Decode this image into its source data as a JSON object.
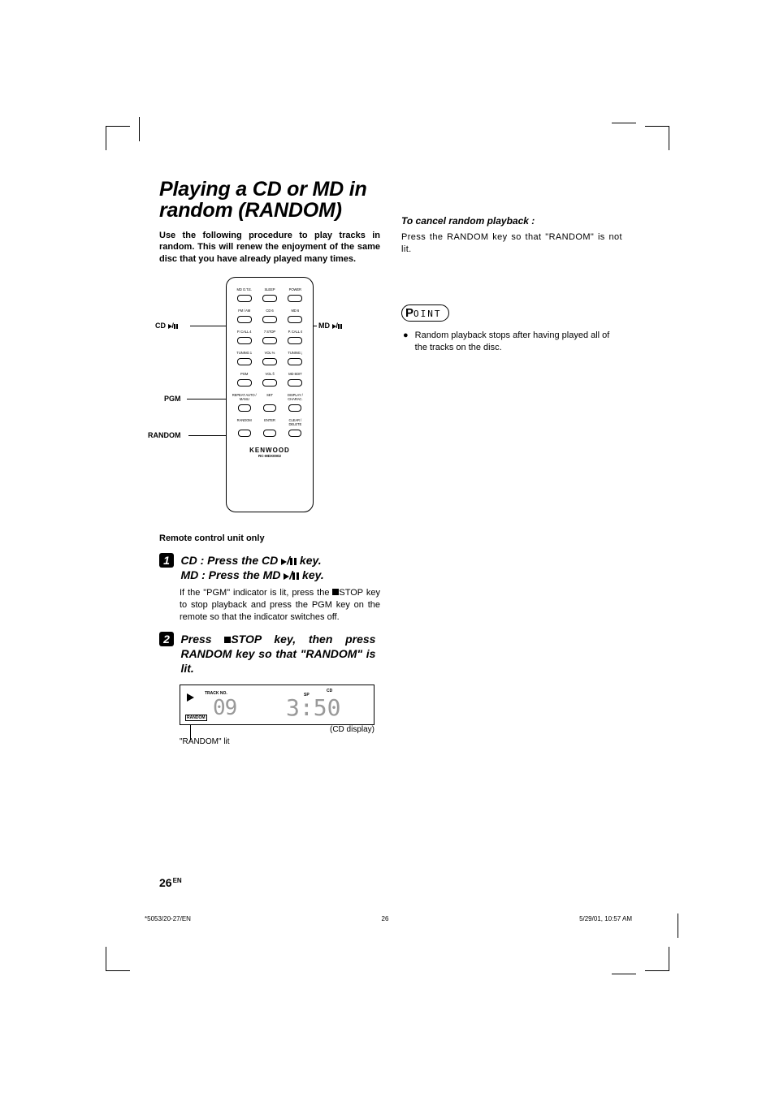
{
  "title": "Playing a CD or MD in  random (RANDOM)",
  "intro": "Use the following procedure to play tracks in random. This will renew the enjoyment of the same disc that you have already played many times.",
  "remote": {
    "row1": [
      "MD O.T.E.",
      "SLEEP",
      "POWER"
    ],
    "row2": [
      "FM / AM",
      "CD 6",
      "MD 6"
    ],
    "row3": [
      "P. CALL 4",
      "7 STOP",
      "P. CALL ¢"
    ],
    "row4": [
      "TUNING 1",
      "VOL %",
      "TUNING ¡"
    ],
    "row5": [
      "PGM",
      "VOL fi",
      "MD EDIT"
    ],
    "row6": [
      "REPEAT AUTO / MANU",
      "SET",
      "DISPLAY / CHARAC."
    ],
    "row7": [
      "RANDOM",
      "ENTER",
      "CLEAR / DELETE"
    ],
    "brand": "KENWOOD",
    "model": "RC-MDX0002"
  },
  "callouts": {
    "cd": "CD 6",
    "md": "MD 6",
    "pgm": "PGM",
    "random": "RANDOM"
  },
  "note_only": "Remote control unit only",
  "step1": {
    "num": "1",
    "line_a_prefix": "CD  :  Press the CD",
    "line_a_suffix": " key.",
    "line_b_prefix": "MD :  Press the MD",
    "line_b_suffix": " key.",
    "body_a": "If the \"PGM\" indicator is lit, press the ",
    "body_b": "STOP key to stop playback and press the PGM key on the remote so that the indicator switches off."
  },
  "step2": {
    "num": "2",
    "head_a": "Press ",
    "head_b": "STOP key, then press RANDOM key so that \"RANDOM\" is lit."
  },
  "display": {
    "track_label": "TRACK NO.",
    "track_no": "09",
    "sp": "SP",
    "cd": "CD",
    "time": "3:50",
    "random": "RANDOM",
    "caption_right": "(CD display)",
    "caption_left": "\"RANDOM\" lit"
  },
  "cancel": {
    "head": "To cancel random playback :",
    "body": "Press the RANDOM key so that \"RANDOM\" is not lit."
  },
  "point": {
    "label": "OINT",
    "bullet": "Random playback stops after having played all of the tracks on the disc."
  },
  "pagenum": "26",
  "pagenum_lang": "EN",
  "footer": {
    "left": "*5053/20-27/EN",
    "mid": "26",
    "right": "5/29/01, 10:57 AM"
  }
}
